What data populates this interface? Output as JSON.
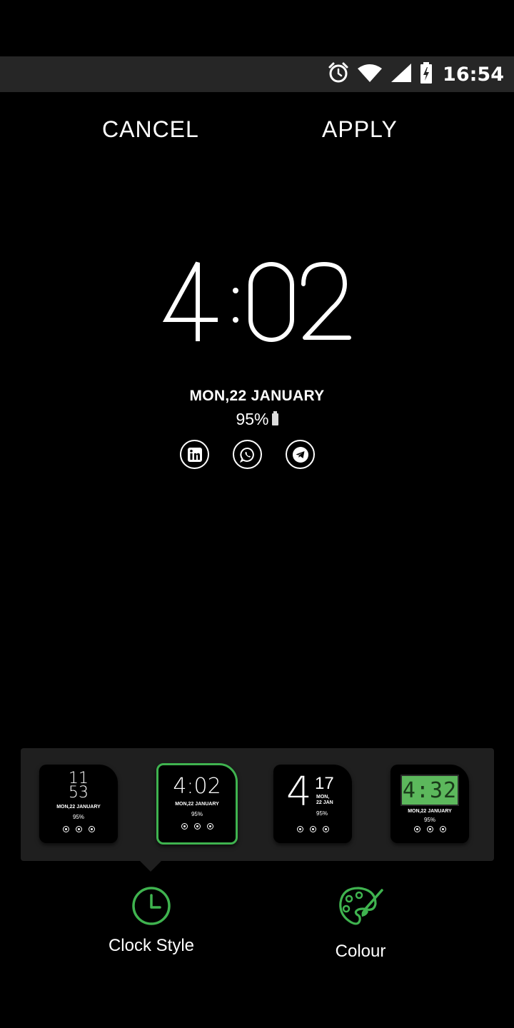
{
  "status_bar": {
    "time": "16:54",
    "icons": [
      "alarm-icon",
      "wifi-icon",
      "signal-icon",
      "battery-charging-icon"
    ]
  },
  "actions": {
    "cancel_label": "CANCEL",
    "apply_label": "APPLY"
  },
  "preview": {
    "time": "4:02",
    "date": "MON,22 JANUARY",
    "battery": "95%",
    "apps": [
      "linkedin-icon",
      "whatsapp-icon",
      "telegram-icon"
    ]
  },
  "styles": [
    {
      "hour": "11",
      "minute": "53",
      "date": "MON,22 JANUARY",
      "battery": "95%"
    },
    {
      "time": "4:02",
      "date": "MON,22 JANUARY",
      "battery": "95%",
      "selected": true
    },
    {
      "hour": "4",
      "minute": "17",
      "day": "MON,",
      "date": "22 JAN",
      "battery": "95%"
    },
    {
      "time": "4:32",
      "date": "MON,22 JANUARY",
      "battery": "95%"
    }
  ],
  "tabs": {
    "clock_style_label": "Clock Style",
    "colour_label": "Colour"
  },
  "colors": {
    "accent": "#3fb34f",
    "lcd_bg": "#5cb85c",
    "panel_bg": "#1f1f1f",
    "status_bar_bg": "#262626"
  }
}
